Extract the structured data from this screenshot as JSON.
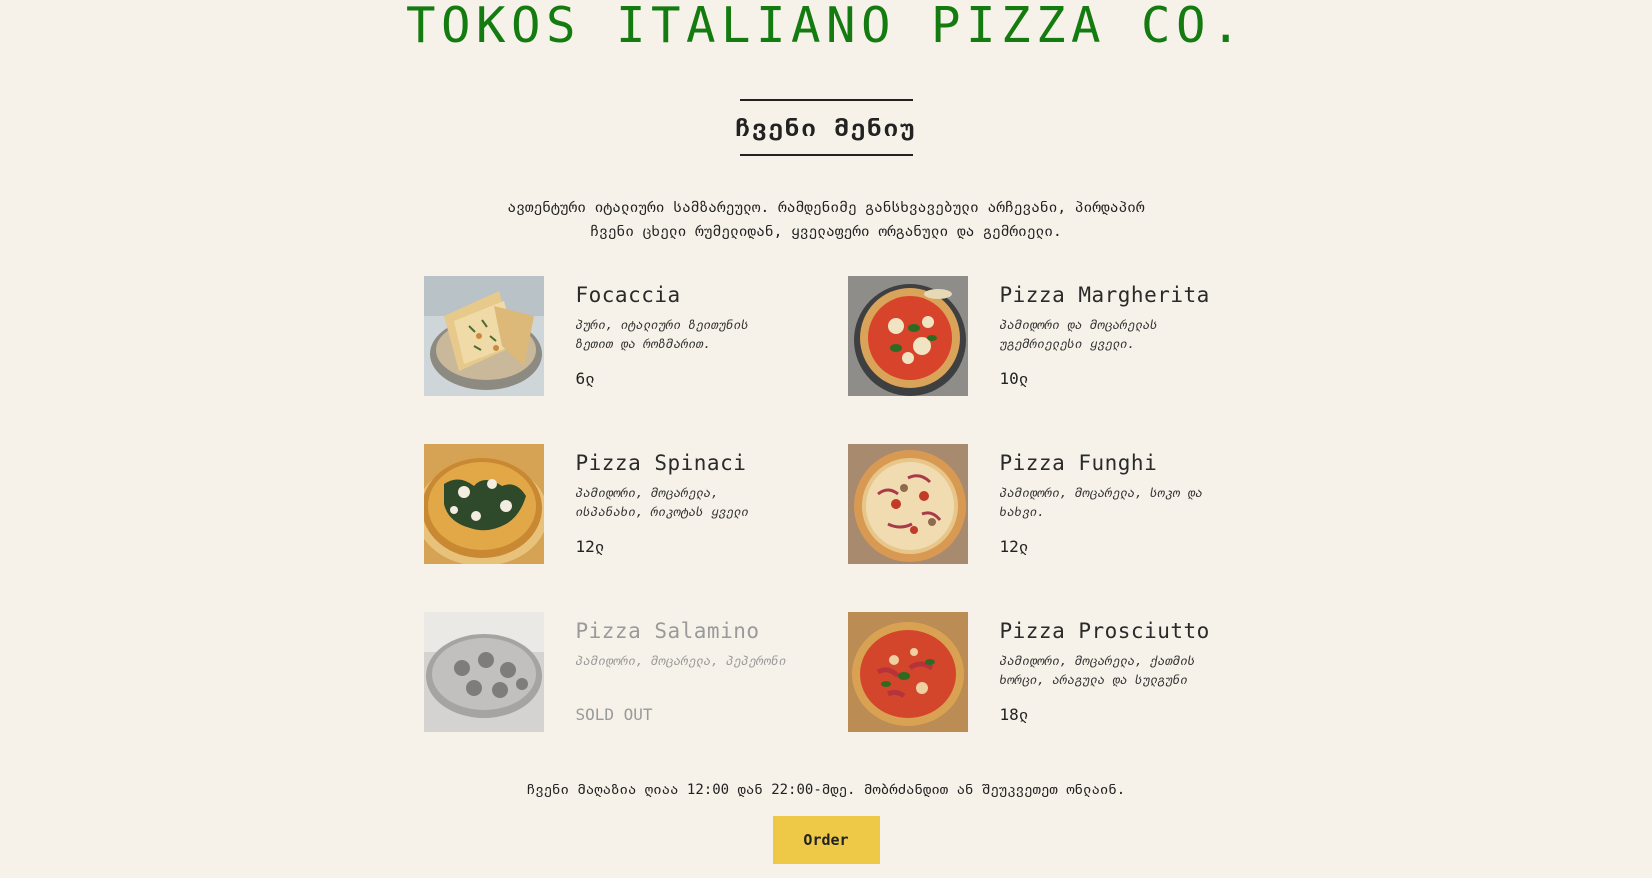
{
  "header": {
    "title": "TOKOS ITALIANO PIZZA CO.",
    "accent_color": "#137b10",
    "dash_color": "#e8c23e"
  },
  "menu": {
    "heading": "ჩვენი მენიუ",
    "intro": "ავთენტური იტალიური სამზარეულო. რამდენიმე განსხვავებული არჩევანი, პირდაპირ ჩვენი ცხელი რუმელიდან, ყველაფერი ორგანული და გემრიელი.",
    "items": [
      {
        "name": "Focaccia",
        "desc": "პური, იტალიური ზეითუნის ზეთით და როზმარით.",
        "price": "6ლ",
        "image": "focaccia-photo",
        "sold_out": false
      },
      {
        "name": "Pizza Margherita",
        "desc": "პამიდორი და მოცარელას უგემრიელესი ყველი.",
        "price": "10ლ",
        "image": "margherita-photo",
        "sold_out": false
      },
      {
        "name": "Pizza Spinaci",
        "desc": "პამიდორი, მოცარელა, ისპანახი, რიკოტას ყველი",
        "price": "12ლ",
        "image": "spinaci-photo",
        "sold_out": false
      },
      {
        "name": "Pizza Funghi",
        "desc": "პამიდორი, მოცარელა, სოკო და ხახვი.",
        "price": "12ლ",
        "image": "funghi-photo",
        "sold_out": false
      },
      {
        "name": "Pizza Salamino",
        "desc": "პამიდორი, მოცარელა, პეპერონი",
        "price": "SOLD OUT",
        "image": "salamino-photo",
        "sold_out": true
      },
      {
        "name": "Pizza Prosciutto",
        "desc": "პამიდორი, მოცარელა, ქათმის ხორცი, არაგულა და სულგუნი",
        "price": "18ლ",
        "image": "prosciutto-photo",
        "sold_out": false
      }
    ]
  },
  "footer": {
    "hours": "ჩვენი მაღაზია ღიაა 12:00 დან 22:00-მდე. მობრძანდით ან შეუკვეთეთ ონლაინ.",
    "order_label": "Order",
    "button_color": "#edc947"
  }
}
